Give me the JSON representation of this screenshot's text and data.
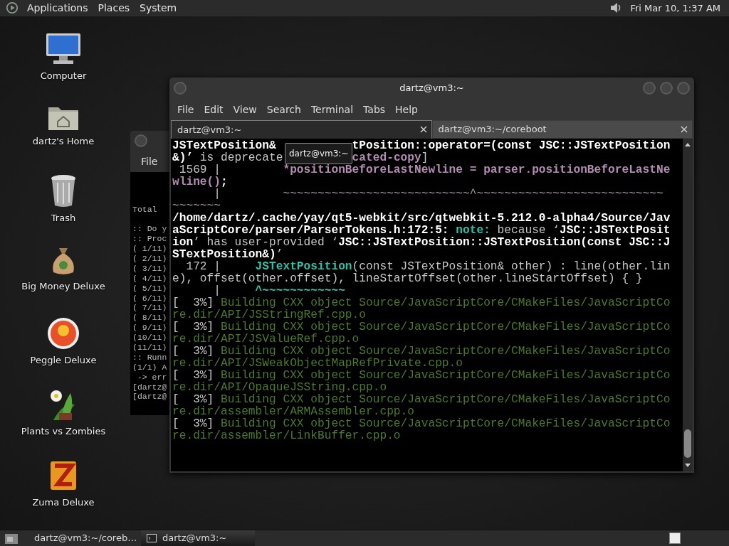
{
  "top_panel": {
    "menus": [
      "Applications",
      "Places",
      "System"
    ],
    "clock": "Fri Mar 10,  1:37 AM"
  },
  "desktop_icons": [
    {
      "label": "Computer",
      "kind": "computer"
    },
    {
      "label": "dartz's Home",
      "kind": "home"
    },
    {
      "label": "Trash",
      "kind": "trash"
    },
    {
      "label": "Big Money Deluxe",
      "kind": "moneybag"
    },
    {
      "label": "Peggle Deluxe",
      "kind": "peggle"
    },
    {
      "label": "Plants vs Zombies",
      "kind": "plants"
    },
    {
      "label": "Zuma Deluxe",
      "kind": "zuma"
    }
  ],
  "back_window": {
    "menu": [
      "File"
    ],
    "blocks": [
      [
        "Total"
      ],
      [
        ":: Do y",
        ":: Proc",
        "( 1/11)",
        "( 2/11)",
        "( 3/11)",
        "( 4/11)",
        "( 5/11)",
        "( 6/11)",
        "( 7/11)",
        "( 8/11)",
        "( 9/11)",
        "(10/11)",
        "(11/11)",
        ":: Runn",
        "(1/1) A",
        " -> err",
        "[dartz@",
        "[dartz@"
      ]
    ]
  },
  "terminal_window": {
    "title": "dartz@vm3:~",
    "menu": [
      "File",
      "Edit",
      "View",
      "Search",
      "Terminal",
      "Tabs",
      "Help"
    ],
    "tabs": [
      {
        "label": "dartz@vm3:~",
        "selected": true
      },
      {
        "label": "dartz@vm3:~/coreboot",
        "selected": false
      }
    ],
    "tooltip": "dartz@vm3:~",
    "lines": [
      {
        "segments": [
          {
            "kind": "bold",
            "text": "JSTextPosition& "
          },
          {
            "kind": "covered"
          },
          {
            "kind": "bold",
            "text": "tPosition::operator=(const JSC::JSTextPosition"
          }
        ]
      },
      {
        "segments": [
          {
            "kind": "bold",
            "text": "&)’"
          },
          {
            "kind": "plain",
            "text": " is deprecate"
          },
          {
            "kind": "covered"
          },
          {
            "kind": "magenta",
            "text": "cated-copy"
          },
          {
            "kind": "plain",
            "text": "]"
          }
        ]
      },
      {
        "segments": [
          {
            "kind": "plain",
            "text": " 1569 |         "
          },
          {
            "kind": "magenta",
            "text": "*positionBeforeLastNewline = parser.positionBeforeLastNe"
          }
        ]
      },
      {
        "segments": [
          {
            "kind": "magenta",
            "text": "wline()"
          },
          {
            "kind": "bold",
            "text": ";"
          }
        ]
      },
      {
        "segments": [
          {
            "kind": "plain",
            "text": "      |         "
          },
          {
            "kind": "tilde",
            "text": "~~~~~~~~~~~~~~~~~~~~~~~~~~~^~~~~~~~~~~~~~~~~~~~~~~~~~~~"
          }
        ]
      },
      {
        "segments": [
          {
            "kind": "tilde",
            "text": "~~~~~~~"
          }
        ]
      },
      {
        "segments": [
          {
            "kind": "bold",
            "text": "/home/dartz/.cache/yay/qt5-webkit/src/qtwebkit-5.212.0-alpha4/Source/Jav"
          }
        ]
      },
      {
        "segments": [
          {
            "kind": "bold",
            "text": "aScriptCore/parser/ParserTokens.h:172:5:"
          },
          {
            "kind": "cyan",
            "text": " note:"
          },
          {
            "kind": "plain",
            "text": " because ‘"
          },
          {
            "kind": "bold",
            "text": "JSC::JSTextPosit"
          }
        ]
      },
      {
        "segments": [
          {
            "kind": "bold",
            "text": "ion"
          },
          {
            "kind": "plain",
            "text": "’ has user-provided ‘"
          },
          {
            "kind": "bold",
            "text": "JSC::JSTextPosition::JSTextPosition(const JSC::J"
          }
        ]
      },
      {
        "segments": [
          {
            "kind": "bold",
            "text": "STextPosition&)"
          },
          {
            "kind": "plain",
            "text": "’"
          }
        ]
      },
      {
        "segments": [
          {
            "kind": "plain",
            "text": "  172 |     "
          },
          {
            "kind": "cyan",
            "text": "JSTextPosition"
          },
          {
            "kind": "plain",
            "text": "(const JSTextPosition& other) : line(other.lin"
          }
        ]
      },
      {
        "segments": [
          {
            "kind": "plain",
            "text": "e), offset(other.offset), lineStartOffset(other.lineStartOffset) { }"
          }
        ]
      },
      {
        "segments": [
          {
            "kind": "plain",
            "text": "      |     "
          },
          {
            "kind": "cyan",
            "text": "^~~~~~~~~~~~~"
          }
        ]
      },
      {
        "segments": [
          {
            "kind": "plain",
            "text": "[  3%]"
          },
          {
            "kind": "green",
            "text": " Building CXX object Source/JavaScriptCore/CMakeFiles/JavaScriptCo"
          }
        ]
      },
      {
        "segments": [
          {
            "kind": "green",
            "text": "re.dir/API/JSStringRef.cpp.o"
          }
        ]
      },
      {
        "segments": [
          {
            "kind": "plain",
            "text": "[  3%]"
          },
          {
            "kind": "green",
            "text": " Building CXX object Source/JavaScriptCore/CMakeFiles/JavaScriptCo"
          }
        ]
      },
      {
        "segments": [
          {
            "kind": "green",
            "text": "re.dir/API/JSValueRef.cpp.o"
          }
        ]
      },
      {
        "segments": [
          {
            "kind": "plain",
            "text": "[  3%]"
          },
          {
            "kind": "green",
            "text": " Building CXX object Source/JavaScriptCore/CMakeFiles/JavaScriptCo"
          }
        ]
      },
      {
        "segments": [
          {
            "kind": "green",
            "text": "re.dir/API/JSWeakObjectMapRefPrivate.cpp.o"
          }
        ]
      },
      {
        "segments": [
          {
            "kind": "plain",
            "text": "[  3%]"
          },
          {
            "kind": "green",
            "text": " Building CXX object Source/JavaScriptCore/CMakeFiles/JavaScriptCo"
          }
        ]
      },
      {
        "segments": [
          {
            "kind": "green",
            "text": "re.dir/API/OpaqueJSString.cpp.o"
          }
        ]
      },
      {
        "segments": [
          {
            "kind": "plain",
            "text": "[  3%]"
          },
          {
            "kind": "green",
            "text": " Building CXX object Source/JavaScriptCore/CMakeFiles/JavaScriptCo"
          }
        ]
      },
      {
        "segments": [
          {
            "kind": "green",
            "text": "re.dir/assembler/ARMAssembler.cpp.o"
          }
        ]
      },
      {
        "segments": [
          {
            "kind": "plain",
            "text": "[  3%]"
          },
          {
            "kind": "green",
            "text": " Building CXX object Source/JavaScriptCore/CMakeFiles/JavaScriptCo"
          }
        ]
      },
      {
        "segments": [
          {
            "kind": "green",
            "text": "re.dir/assembler/LinkBuffer.cpp.o"
          }
        ]
      }
    ]
  },
  "taskbar": {
    "tasks": [
      {
        "label": "dartz@vm3:~/coreb…",
        "selected": false
      },
      {
        "label": "dartz@vm3:~",
        "selected": true
      }
    ]
  }
}
